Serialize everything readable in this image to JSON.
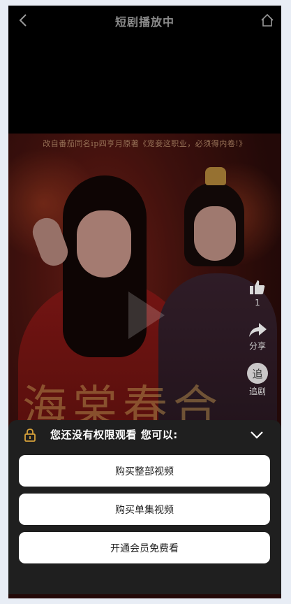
{
  "header": {
    "title": "短剧播放中",
    "back_icon": "chevron-left-icon",
    "home_icon": "home-icon"
  },
  "poster": {
    "caption": "改自番茄同名ip四亨月原著《宠妾这职业，必须得内卷!》",
    "calligraphy": "海棠春合"
  },
  "actions": {
    "like_count": "1",
    "share_label": "分享",
    "chase_glyph": "追",
    "chase_label": "追剧"
  },
  "paywall": {
    "title": "您还没有权限观看 您可以:",
    "lock_icon": "lock-icon",
    "collapse_icon": "chevron-down-icon",
    "options": [
      "购买整部视频",
      "购买单集视频",
      "开通会员免费看"
    ]
  },
  "colors": {
    "page_bg": "#e8edf5",
    "sheet_bg": "#1f1f1f",
    "lock_accent": "#d6a13a",
    "button_bg": "#ffffff"
  }
}
